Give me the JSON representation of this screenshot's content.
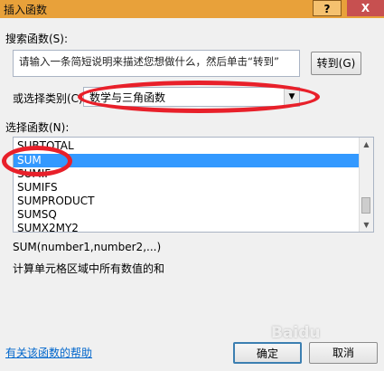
{
  "window": {
    "title": "插入函数",
    "help_label": "?",
    "close_label": "X"
  },
  "search": {
    "label": "搜索函数(S):",
    "value": "请输入一条简短说明来描述您想做什么，然后单击“转到”",
    "goto_label": "转到(G)"
  },
  "category": {
    "label": "或选择类别(C):",
    "selected": "数学与三角函数"
  },
  "function_list": {
    "label": "选择函数(N):",
    "items": [
      "SUBTOTAL",
      "SUM",
      "SUMIF",
      "SUMIFS",
      "SUMPRODUCT",
      "SUMSQ",
      "SUMX2MY2"
    ],
    "selected": "SUM"
  },
  "details": {
    "syntax": "SUM(number1,number2,...)",
    "description": "计算单元格区域中所有数值的和"
  },
  "footer": {
    "help_link": "有关该函数的帮助",
    "ok_label": "确定",
    "cancel_label": "取消"
  },
  "watermark": "Baidu",
  "colors": {
    "titlebar": "#e8a13a",
    "selection": "#3399ff",
    "annotation": "#e8202a",
    "link": "#0066cc"
  }
}
